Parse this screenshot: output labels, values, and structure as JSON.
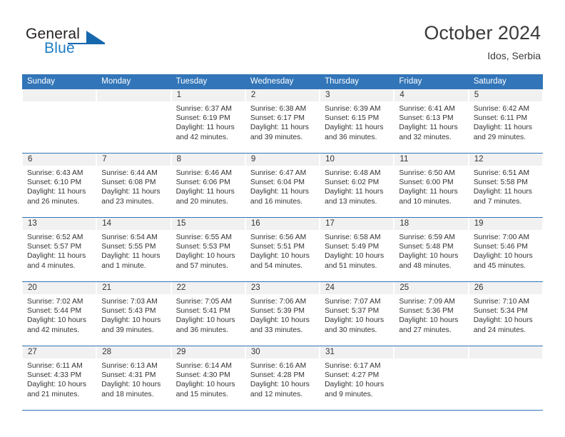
{
  "brand": {
    "name_top": "General",
    "name_bottom": "Blue"
  },
  "header": {
    "title": "October 2024",
    "subtitle": "Idos, Serbia"
  },
  "colors": {
    "header_blue": "#3275b8",
    "brand_blue": "#1d7dc4",
    "band_gray": "#f1f1f1",
    "text": "#333333"
  },
  "labels": {
    "sunrise_prefix": "Sunrise:",
    "sunset_prefix": "Sunset:",
    "daylight_prefix": "Daylight:"
  },
  "weekdays": [
    "Sunday",
    "Monday",
    "Tuesday",
    "Wednesday",
    "Thursday",
    "Friday",
    "Saturday"
  ],
  "weeks": [
    [
      {
        "day": "",
        "sunrise": "",
        "sunset": "",
        "daylight_line1": "",
        "daylight_line2": ""
      },
      {
        "day": "",
        "sunrise": "",
        "sunset": "",
        "daylight_line1": "",
        "daylight_line2": ""
      },
      {
        "day": "1",
        "sunrise": "Sunrise: 6:37 AM",
        "sunset": "Sunset: 6:19 PM",
        "daylight_line1": "Daylight: 11 hours",
        "daylight_line2": "and 42 minutes."
      },
      {
        "day": "2",
        "sunrise": "Sunrise: 6:38 AM",
        "sunset": "Sunset: 6:17 PM",
        "daylight_line1": "Daylight: 11 hours",
        "daylight_line2": "and 39 minutes."
      },
      {
        "day": "3",
        "sunrise": "Sunrise: 6:39 AM",
        "sunset": "Sunset: 6:15 PM",
        "daylight_line1": "Daylight: 11 hours",
        "daylight_line2": "and 36 minutes."
      },
      {
        "day": "4",
        "sunrise": "Sunrise: 6:41 AM",
        "sunset": "Sunset: 6:13 PM",
        "daylight_line1": "Daylight: 11 hours",
        "daylight_line2": "and 32 minutes."
      },
      {
        "day": "5",
        "sunrise": "Sunrise: 6:42 AM",
        "sunset": "Sunset: 6:11 PM",
        "daylight_line1": "Daylight: 11 hours",
        "daylight_line2": "and 29 minutes."
      }
    ],
    [
      {
        "day": "6",
        "sunrise": "Sunrise: 6:43 AM",
        "sunset": "Sunset: 6:10 PM",
        "daylight_line1": "Daylight: 11 hours",
        "daylight_line2": "and 26 minutes."
      },
      {
        "day": "7",
        "sunrise": "Sunrise: 6:44 AM",
        "sunset": "Sunset: 6:08 PM",
        "daylight_line1": "Daylight: 11 hours",
        "daylight_line2": "and 23 minutes."
      },
      {
        "day": "8",
        "sunrise": "Sunrise: 6:46 AM",
        "sunset": "Sunset: 6:06 PM",
        "daylight_line1": "Daylight: 11 hours",
        "daylight_line2": "and 20 minutes."
      },
      {
        "day": "9",
        "sunrise": "Sunrise: 6:47 AM",
        "sunset": "Sunset: 6:04 PM",
        "daylight_line1": "Daylight: 11 hours",
        "daylight_line2": "and 16 minutes."
      },
      {
        "day": "10",
        "sunrise": "Sunrise: 6:48 AM",
        "sunset": "Sunset: 6:02 PM",
        "daylight_line1": "Daylight: 11 hours",
        "daylight_line2": "and 13 minutes."
      },
      {
        "day": "11",
        "sunrise": "Sunrise: 6:50 AM",
        "sunset": "Sunset: 6:00 PM",
        "daylight_line1": "Daylight: 11 hours",
        "daylight_line2": "and 10 minutes."
      },
      {
        "day": "12",
        "sunrise": "Sunrise: 6:51 AM",
        "sunset": "Sunset: 5:58 PM",
        "daylight_line1": "Daylight: 11 hours",
        "daylight_line2": "and 7 minutes."
      }
    ],
    [
      {
        "day": "13",
        "sunrise": "Sunrise: 6:52 AM",
        "sunset": "Sunset: 5:57 PM",
        "daylight_line1": "Daylight: 11 hours",
        "daylight_line2": "and 4 minutes."
      },
      {
        "day": "14",
        "sunrise": "Sunrise: 6:54 AM",
        "sunset": "Sunset: 5:55 PM",
        "daylight_line1": "Daylight: 11 hours",
        "daylight_line2": "and 1 minute."
      },
      {
        "day": "15",
        "sunrise": "Sunrise: 6:55 AM",
        "sunset": "Sunset: 5:53 PM",
        "daylight_line1": "Daylight: 10 hours",
        "daylight_line2": "and 57 minutes."
      },
      {
        "day": "16",
        "sunrise": "Sunrise: 6:56 AM",
        "sunset": "Sunset: 5:51 PM",
        "daylight_line1": "Daylight: 10 hours",
        "daylight_line2": "and 54 minutes."
      },
      {
        "day": "17",
        "sunrise": "Sunrise: 6:58 AM",
        "sunset": "Sunset: 5:49 PM",
        "daylight_line1": "Daylight: 10 hours",
        "daylight_line2": "and 51 minutes."
      },
      {
        "day": "18",
        "sunrise": "Sunrise: 6:59 AM",
        "sunset": "Sunset: 5:48 PM",
        "daylight_line1": "Daylight: 10 hours",
        "daylight_line2": "and 48 minutes."
      },
      {
        "day": "19",
        "sunrise": "Sunrise: 7:00 AM",
        "sunset": "Sunset: 5:46 PM",
        "daylight_line1": "Daylight: 10 hours",
        "daylight_line2": "and 45 minutes."
      }
    ],
    [
      {
        "day": "20",
        "sunrise": "Sunrise: 7:02 AM",
        "sunset": "Sunset: 5:44 PM",
        "daylight_line1": "Daylight: 10 hours",
        "daylight_line2": "and 42 minutes."
      },
      {
        "day": "21",
        "sunrise": "Sunrise: 7:03 AM",
        "sunset": "Sunset: 5:43 PM",
        "daylight_line1": "Daylight: 10 hours",
        "daylight_line2": "and 39 minutes."
      },
      {
        "day": "22",
        "sunrise": "Sunrise: 7:05 AM",
        "sunset": "Sunset: 5:41 PM",
        "daylight_line1": "Daylight: 10 hours",
        "daylight_line2": "and 36 minutes."
      },
      {
        "day": "23",
        "sunrise": "Sunrise: 7:06 AM",
        "sunset": "Sunset: 5:39 PM",
        "daylight_line1": "Daylight: 10 hours",
        "daylight_line2": "and 33 minutes."
      },
      {
        "day": "24",
        "sunrise": "Sunrise: 7:07 AM",
        "sunset": "Sunset: 5:37 PM",
        "daylight_line1": "Daylight: 10 hours",
        "daylight_line2": "and 30 minutes."
      },
      {
        "day": "25",
        "sunrise": "Sunrise: 7:09 AM",
        "sunset": "Sunset: 5:36 PM",
        "daylight_line1": "Daylight: 10 hours",
        "daylight_line2": "and 27 minutes."
      },
      {
        "day": "26",
        "sunrise": "Sunrise: 7:10 AM",
        "sunset": "Sunset: 5:34 PM",
        "daylight_line1": "Daylight: 10 hours",
        "daylight_line2": "and 24 minutes."
      }
    ],
    [
      {
        "day": "27",
        "sunrise": "Sunrise: 6:11 AM",
        "sunset": "Sunset: 4:33 PM",
        "daylight_line1": "Daylight: 10 hours",
        "daylight_line2": "and 21 minutes."
      },
      {
        "day": "28",
        "sunrise": "Sunrise: 6:13 AM",
        "sunset": "Sunset: 4:31 PM",
        "daylight_line1": "Daylight: 10 hours",
        "daylight_line2": "and 18 minutes."
      },
      {
        "day": "29",
        "sunrise": "Sunrise: 6:14 AM",
        "sunset": "Sunset: 4:30 PM",
        "daylight_line1": "Daylight: 10 hours",
        "daylight_line2": "and 15 minutes."
      },
      {
        "day": "30",
        "sunrise": "Sunrise: 6:16 AM",
        "sunset": "Sunset: 4:28 PM",
        "daylight_line1": "Daylight: 10 hours",
        "daylight_line2": "and 12 minutes."
      },
      {
        "day": "31",
        "sunrise": "Sunrise: 6:17 AM",
        "sunset": "Sunset: 4:27 PM",
        "daylight_line1": "Daylight: 10 hours",
        "daylight_line2": "and 9 minutes."
      },
      {
        "day": "",
        "sunrise": "",
        "sunset": "",
        "daylight_line1": "",
        "daylight_line2": ""
      },
      {
        "day": "",
        "sunrise": "",
        "sunset": "",
        "daylight_line1": "",
        "daylight_line2": ""
      }
    ]
  ]
}
